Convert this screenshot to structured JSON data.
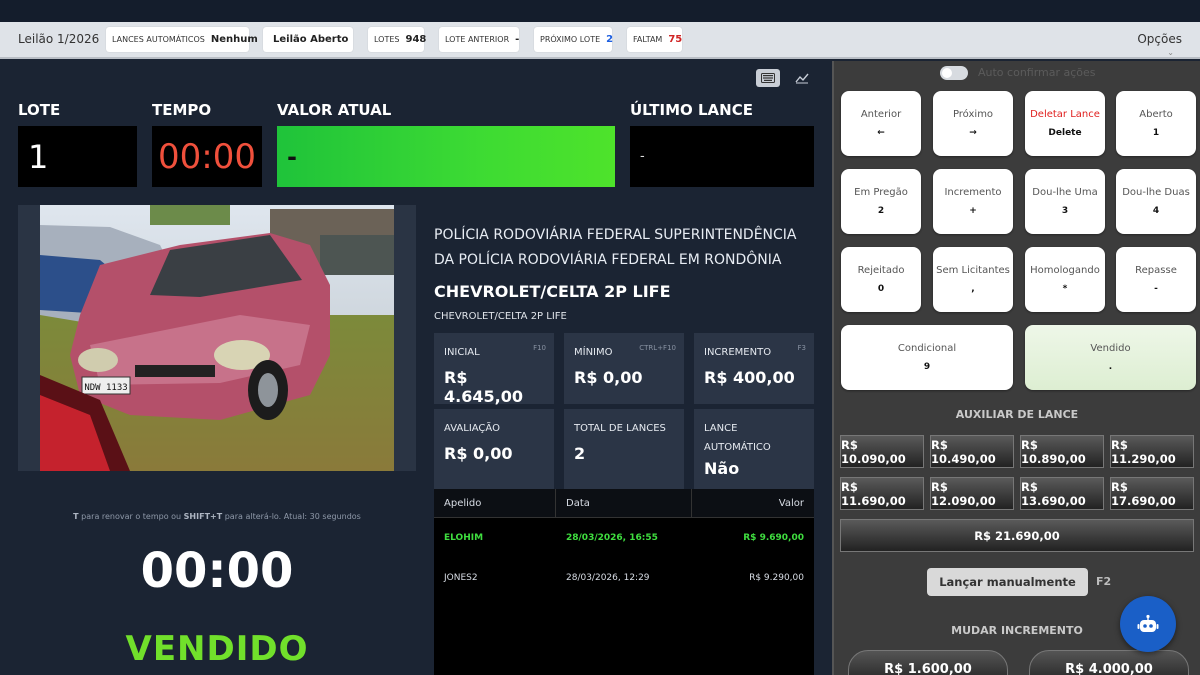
{
  "toolbar": {
    "title": "Leilão 1/2026",
    "lances_auto_label": "LANCES AUTOMÁTICOS",
    "lances_auto_value": "Nenhum",
    "status": "Leilão Aberto",
    "lotes_label": "LOTES",
    "lotes_value": "948",
    "lote_anterior_label": "LOTE ANTERIOR",
    "lote_anterior_value": "-",
    "proximo_lote_label": "PRÓXIMO LOTE",
    "proximo_lote_value": "2",
    "faltam_label": "FALTAM",
    "faltam_value": "75",
    "options": "Opções",
    "status_color": "#24b24a"
  },
  "main": {
    "lote_label": "LOTE",
    "lote_value": "1",
    "tempo_label": "TEMPO",
    "tempo_value": "00:00",
    "valor_label": "VALOR ATUAL",
    "valor_value": "-",
    "ultimo_label": "ÚLTIMO LANCE",
    "ultimo_value": "-",
    "agency": "POLÍCIA RODOVIÁRIA FEDERAL SUPERINTENDÊNCIA DA POLÍCIA RODOVIÁRIA FEDERAL EM RONDÔNIA",
    "car_title": "CHEVROLET/CELTA 2P LIFE",
    "car_sub": "CHEVROLET/CELTA 2P LIFE",
    "plate": "NDW 1133",
    "hint_key1": "T",
    "hint_mid": " para renovar o tempo ou ",
    "hint_key2": "SHIFT+T",
    "hint_end": " para alterá-lo. Atual: 30 segundos",
    "big_time": "00:00",
    "vendido": "VENDIDO"
  },
  "cards": {
    "inicial": {
      "label": "INICIAL",
      "key": "F10",
      "value": "R$ 4.645,00"
    },
    "minimo": {
      "label": "MÍNIMO",
      "key": "CTRL+F10",
      "value": "R$ 0,00"
    },
    "incremento": {
      "label": "INCREMENTO",
      "key": "F3",
      "value": "R$ 400,00"
    },
    "avaliacao": {
      "label": "AVALIAÇÃO",
      "value": "R$ 0,00"
    },
    "total": {
      "label": "TOTAL DE LANCES",
      "value": "2"
    },
    "automatico": {
      "label": "LANCE AUTOMÁTICO",
      "value": "Não"
    }
  },
  "bids": {
    "headers": [
      "Apelido",
      "Data",
      "Valor"
    ],
    "rows": [
      {
        "apelido": "ELOHIM",
        "data": "28/03/2026, 16:55",
        "valor": "R$ 9.690,00"
      },
      {
        "apelido": "JONES2",
        "data": "28/03/2026, 12:29",
        "valor": "R$ 9.290,00"
      }
    ]
  },
  "right": {
    "auto_confirm": "Auto confirmar ações",
    "buttons": [
      {
        "label": "Anterior",
        "key": "←"
      },
      {
        "label": "Próximo",
        "key": "→"
      },
      {
        "label": "Deletar Lance",
        "key": "Delete"
      },
      {
        "label": "Aberto",
        "key": "1"
      },
      {
        "label": "Em Pregão",
        "key": "2"
      },
      {
        "label": "Incremento",
        "key": "+"
      },
      {
        "label": "Dou-lhe Uma",
        "key": "3"
      },
      {
        "label": "Dou-lhe Duas",
        "key": "4"
      },
      {
        "label": "Rejeitado",
        "key": "0"
      },
      {
        "label": "Sem Licitantes",
        "key": ","
      },
      {
        "label": "Homologando",
        "key": "*"
      },
      {
        "label": "Repasse",
        "key": "-"
      },
      {
        "label": "Condicional",
        "key": "9"
      },
      {
        "label": "Vendido",
        "key": "."
      }
    ],
    "aux_title": "AUXILIAR DE LANCE",
    "aux": [
      "R$ 10.090,00",
      "R$ 10.490,00",
      "R$ 10.890,00",
      "R$ 11.290,00",
      "R$ 11.690,00",
      "R$ 12.090,00",
      "R$ 13.690,00",
      "R$ 17.690,00",
      "R$ 21.690,00"
    ],
    "manual": "Lançar manualmente",
    "manual_key": "F2",
    "mudar_title": "MUDAR INCREMENTO",
    "incrementos": [
      "R$ 1.600,00",
      "R$ 4.000,00"
    ]
  }
}
